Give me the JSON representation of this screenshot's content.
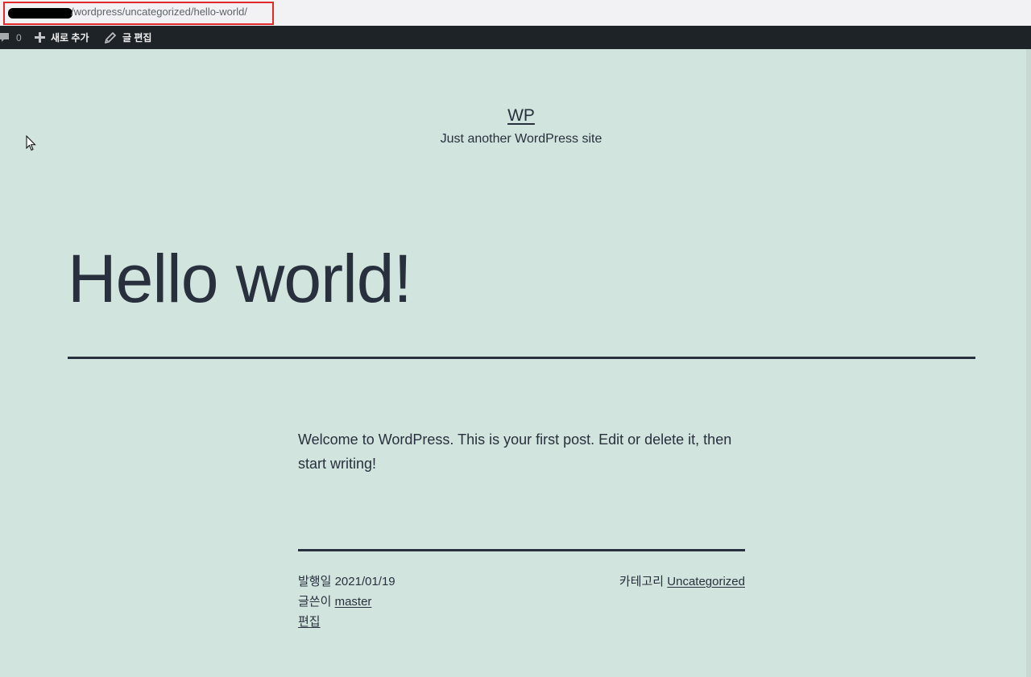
{
  "browser": {
    "url_visible": "/wordpress/uncategorized/hello-world/"
  },
  "admin_bar": {
    "comments_count": "0",
    "new_label": "새로 추가",
    "edit_label": "글 편집"
  },
  "site": {
    "title": "WP",
    "description": "Just another WordPress site"
  },
  "post": {
    "title": "Hello world!",
    "content": "Welcome to WordPress. This is your first post. Edit or delete it, then start writing!",
    "published_label": "발행일",
    "published_date": "2021/01/19",
    "author_label": "글쓴이",
    "author": "master",
    "edit_link": "편집",
    "category_label": "카테고리",
    "category": "Uncategorized"
  },
  "colors": {
    "background": "#d1e4dd",
    "text": "#28303d",
    "admin_bar": "#1d2327",
    "highlight": "#e32a2a"
  }
}
